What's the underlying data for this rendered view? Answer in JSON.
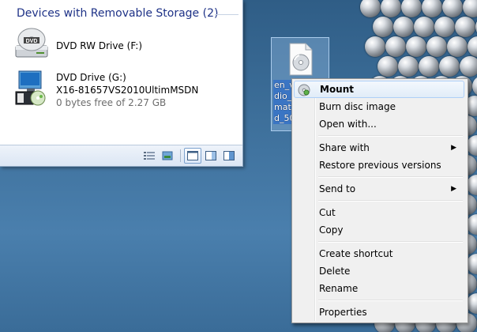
{
  "explorer": {
    "group_header": "Devices with Removable Storage (2)",
    "drives": [
      {
        "icon": "dvd-rw-drive-icon",
        "name": "DVD RW Drive (F:)"
      },
      {
        "icon": "dvd-setup-icon",
        "name": "DVD Drive (G:)",
        "label": "X16-81657VS2010UltimMSDN",
        "space": "0 bytes free of 2.27 GB"
      }
    ]
  },
  "desktop_file": {
    "icon": "disc-image-file-icon",
    "label_lines": [
      "en_v",
      "dio_",
      "mat",
      "d_50"
    ]
  },
  "context_menu": {
    "items": [
      {
        "label": "Mount",
        "bold": true,
        "hover": true,
        "icon": "mount-disc-icon"
      },
      {
        "label": "Burn disc image"
      },
      {
        "label": "Open with..."
      },
      {
        "label": "Share with",
        "submenu": true
      },
      {
        "label": "Restore previous versions"
      },
      {
        "label": "Send to",
        "submenu": true
      },
      {
        "label": "Cut"
      },
      {
        "label": "Copy"
      },
      {
        "label": "Create shortcut"
      },
      {
        "label": "Delete"
      },
      {
        "label": "Rename"
      },
      {
        "label": "Properties"
      }
    ]
  },
  "colors": {
    "desktop": "#3d6f9a",
    "header_text": "#1e3287",
    "menu_bg": "#f0f0f0",
    "hover_border": "#aecff7"
  }
}
